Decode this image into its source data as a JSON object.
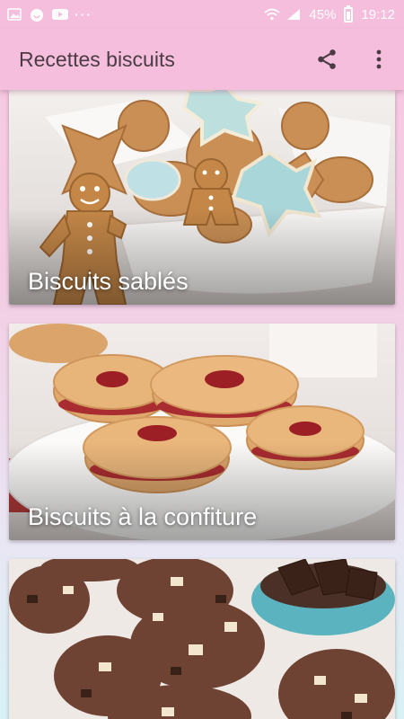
{
  "status_bar": {
    "notification_icons": [
      "image-icon",
      "smiley-icon",
      "youtube-icon"
    ],
    "overflow_dots": "···",
    "battery_percent": "45%",
    "time": "19:12"
  },
  "app_bar": {
    "title": "Recettes biscuits",
    "share_icon": "share-icon",
    "menu_icon": "more-vert-icon"
  },
  "recipes": [
    {
      "label": "Biscuits sablés"
    },
    {
      "label": "Biscuits à la confiture"
    },
    {
      "label": ""
    }
  ],
  "colors": {
    "app_bar": "#f4bedc",
    "title_text": "#4a3b44"
  }
}
